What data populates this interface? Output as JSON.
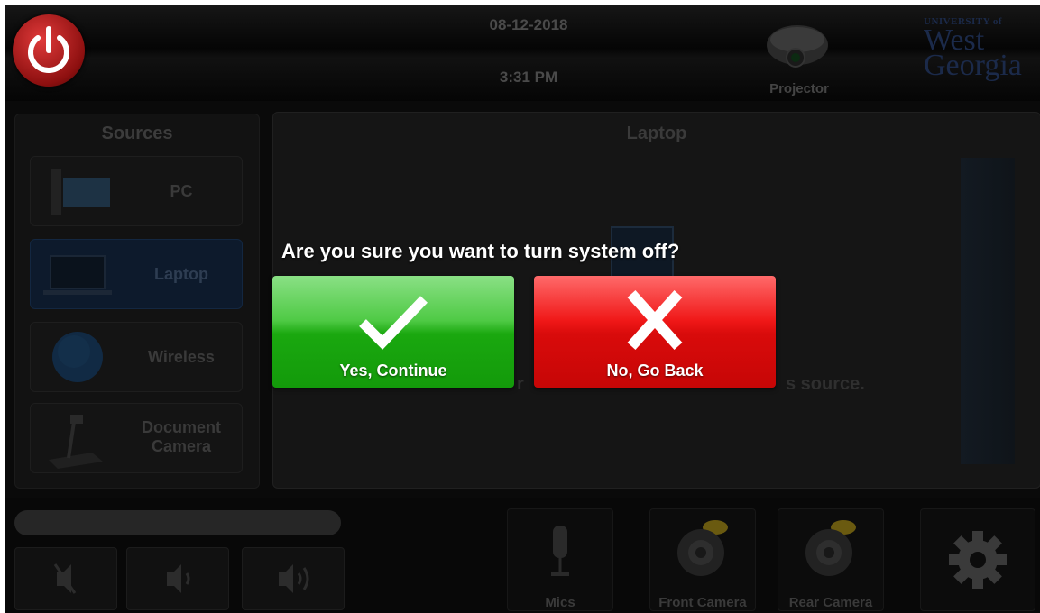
{
  "header": {
    "date": "08-12-2018",
    "time": "3:31 PM",
    "projector_label": "Projector",
    "logo": {
      "university": "UNIVERSITY of",
      "west": "West",
      "georgia": "Georgia"
    }
  },
  "sources": {
    "title": "Sources",
    "items": [
      {
        "label": "PC",
        "icon": "pc-icon",
        "selected": false
      },
      {
        "label": "Laptop",
        "icon": "laptop-icon",
        "selected": true
      },
      {
        "label": "Wireless",
        "icon": "globe-icon",
        "selected": false
      },
      {
        "label": "Document",
        "label2": "Camera",
        "icon": "document-camera-icon",
        "selected": false
      }
    ]
  },
  "main": {
    "title": "Laptop",
    "ghost_left": "r",
    "ghost_right": "s source."
  },
  "dialog": {
    "question": "Are you sure you want to turn system off?",
    "yes_label": "Yes, Continue",
    "no_label": "No, Go Back"
  },
  "bottom": {
    "mics_label": "Mics",
    "front_camera_label": "Front Camera",
    "rear_camera_label": "Rear Camera"
  }
}
